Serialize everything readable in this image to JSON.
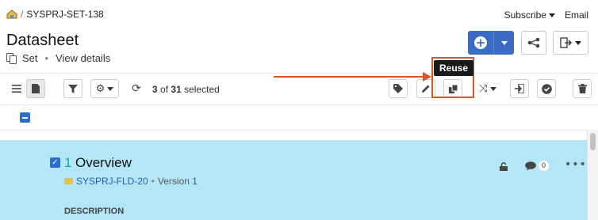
{
  "breadcrumb": {
    "project": "SYSPRJ-SET-138",
    "separator": "/",
    "icon": "project-home-icon"
  },
  "header_links": {
    "subscribe": "Subscribe",
    "email": "Email"
  },
  "page": {
    "title": "Datasheet",
    "type": "Set",
    "separator": "•",
    "view_details": "View details"
  },
  "toolbar": {
    "selection": {
      "selected": "3",
      "of_word": "of",
      "total": "31",
      "suffix": "selected"
    },
    "tooltip": "Reuse",
    "icons": [
      "list-view-icon",
      "document-view-icon",
      "filter-icon",
      "gear-icon",
      "refresh-icon",
      "tag-icon",
      "pencil-icon",
      "reuse-icon",
      "shuffle-icon",
      "export-icon",
      "approve-icon",
      "trash-icon"
    ]
  },
  "item": {
    "number": "1",
    "title": "Overview",
    "folder_id": "SYSPRJ-FLD-20",
    "separator": "•",
    "version": "Version 1",
    "comment_count": "0",
    "description_label": "DESCRIPTION"
  },
  "colors": {
    "accent": "#3a6bc5",
    "annotation": "#d9552b",
    "row_highlight": "#b3e6f7",
    "item_number": "#1aa3a3"
  }
}
